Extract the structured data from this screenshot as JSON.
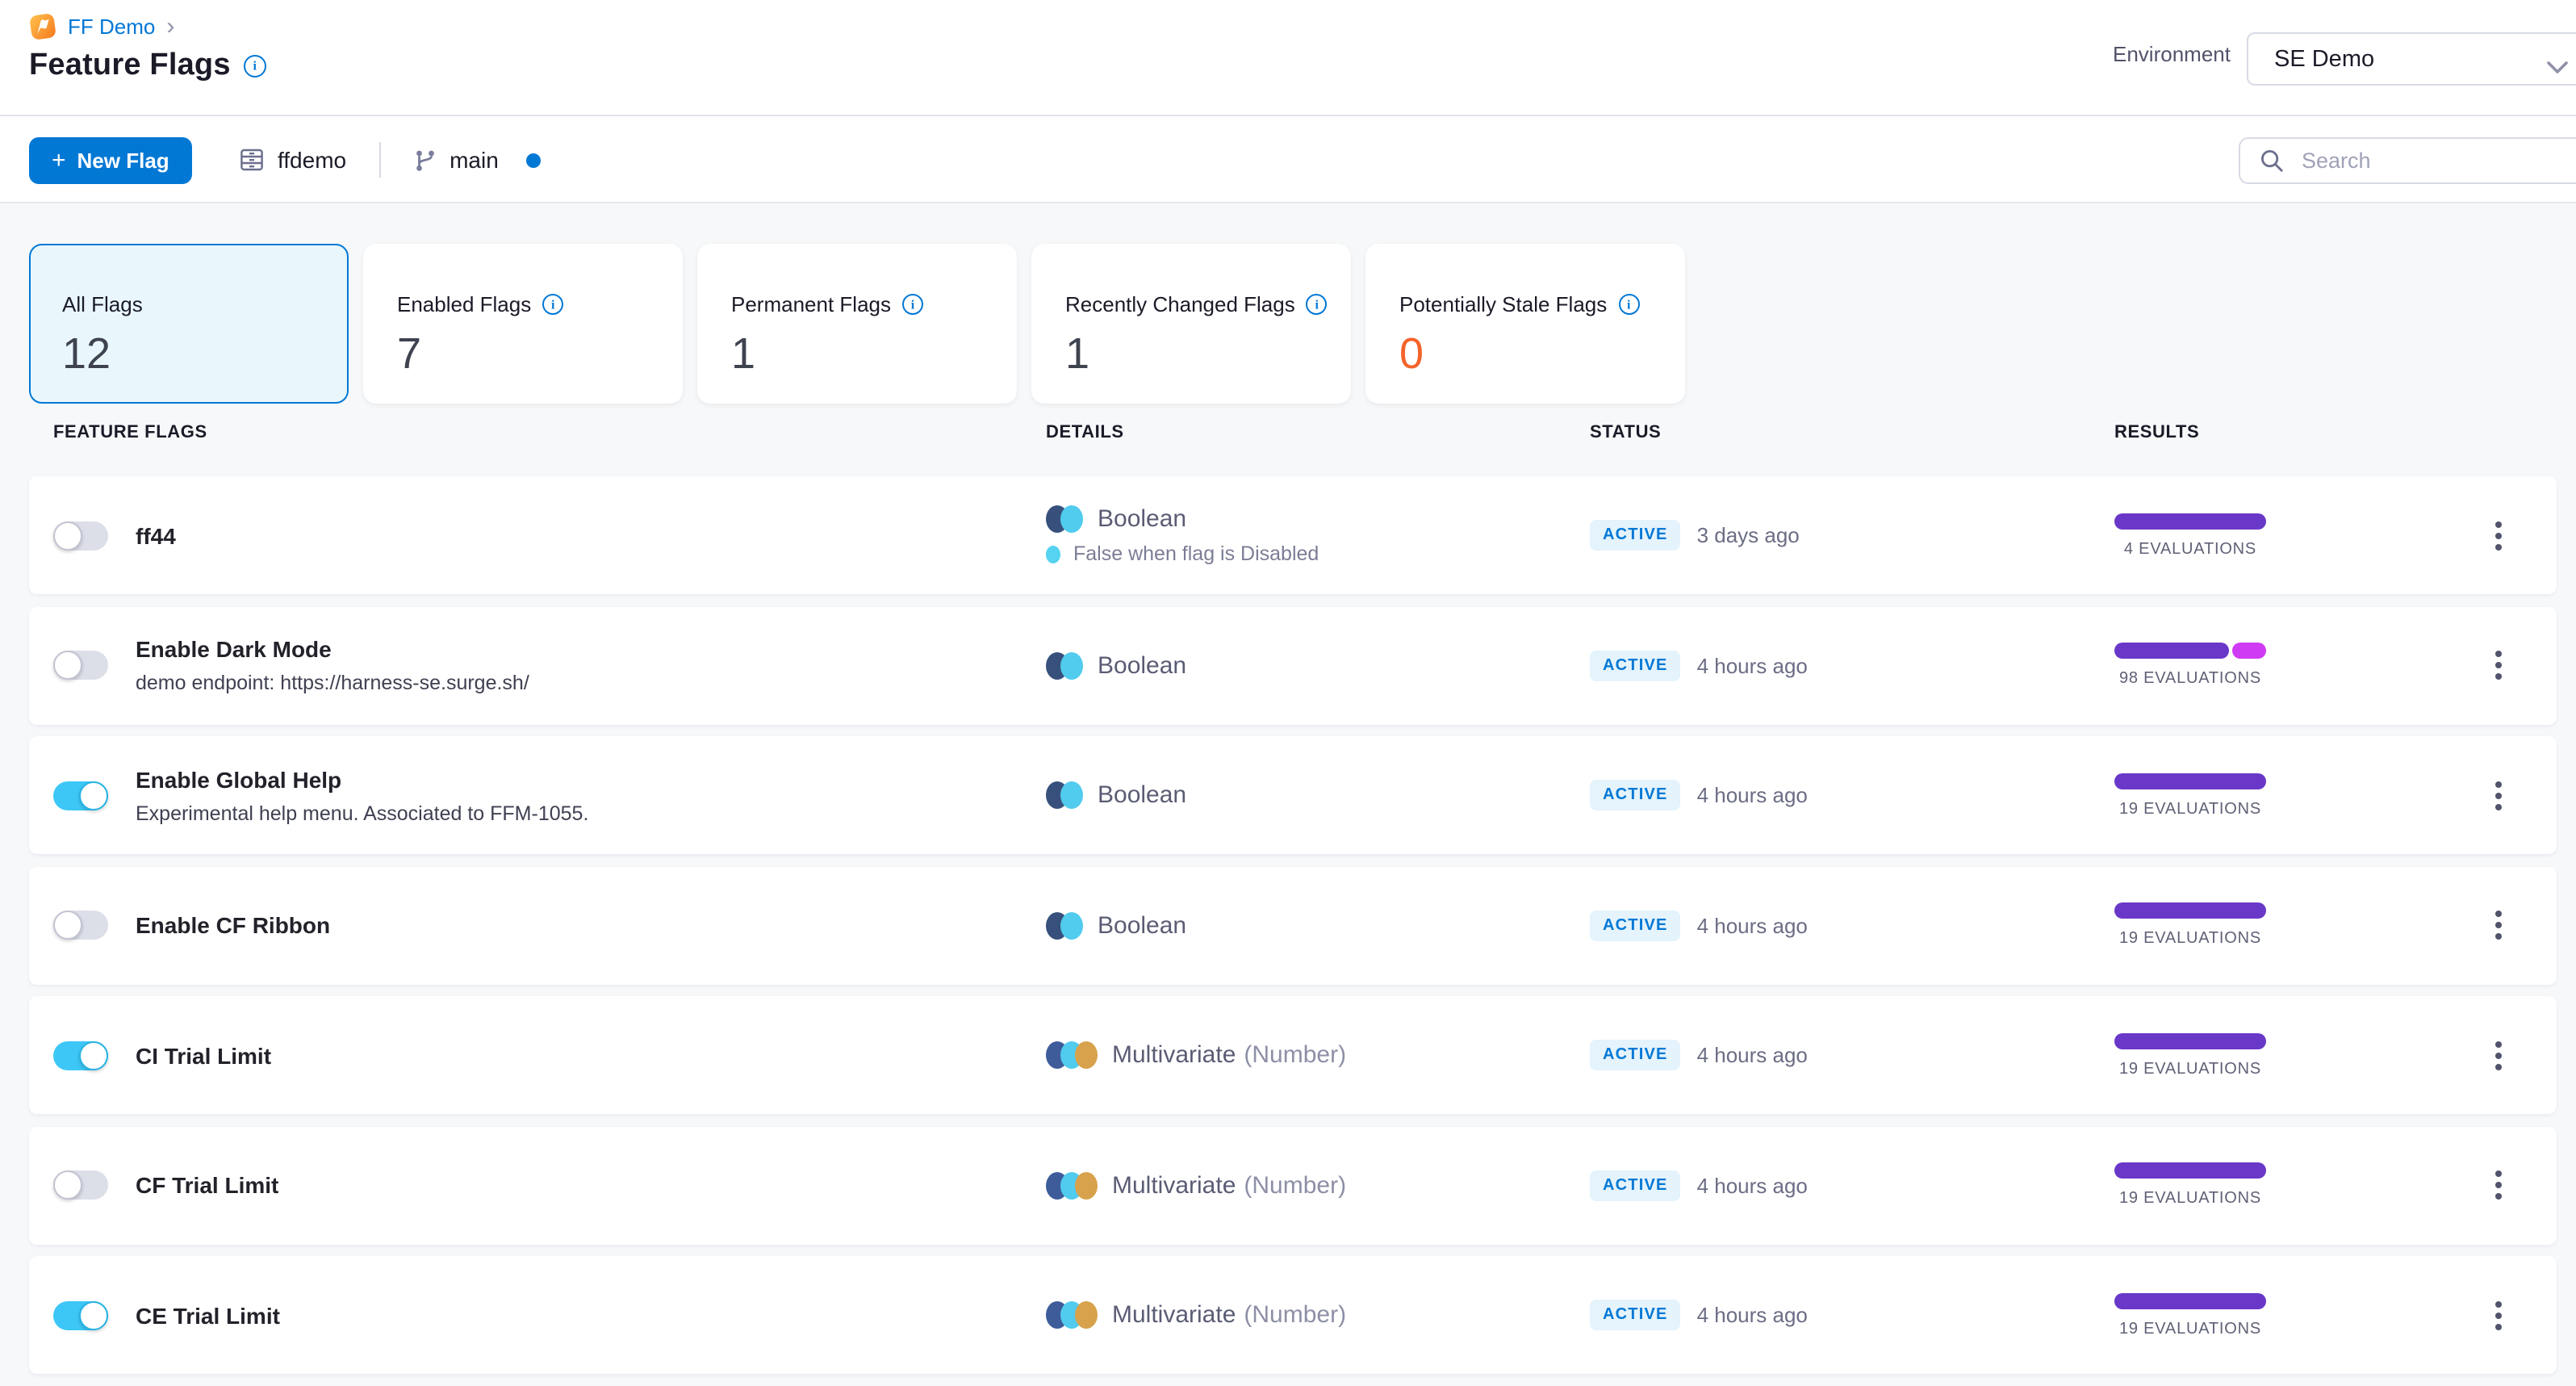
{
  "breadcrumb": {
    "project": "FF Demo",
    "chevron": "›"
  },
  "header": {
    "title": "Feature Flags",
    "environment_label": "Environment",
    "environment_value": "SE Demo"
  },
  "toolbar": {
    "new_flag_plus": "+",
    "new_flag_label": "New Flag",
    "repo_name": "ffdemo",
    "branch_name": "main",
    "search_placeholder": "Search"
  },
  "colors": {
    "accent_blue": "#0278d5",
    "toggle_on": "#3dc7f6",
    "bar_purple": "#6938c8",
    "bar_magenta": "#cf3bf3",
    "stale_orange": "#f4632a",
    "badge_bg": "#e4f3fc"
  },
  "icons": [
    "feature-flags-logo",
    "info-icon",
    "chevron-down-icon",
    "plus-icon",
    "repo-icon",
    "git-branch-icon",
    "branch-status-dot",
    "search-icon",
    "kebab-menu-icon",
    "boolean-type-icon",
    "multivariate-type-icon"
  ],
  "stats": [
    {
      "label": "All Flags",
      "value": "12",
      "selected": true,
      "info": false
    },
    {
      "label": "Enabled Flags",
      "value": "7",
      "selected": false,
      "info": true
    },
    {
      "label": "Permanent Flags",
      "value": "1",
      "selected": false,
      "info": true
    },
    {
      "label": "Recently Changed Flags",
      "value": "1",
      "selected": false,
      "info": true
    },
    {
      "label": "Potentially Stale Flags",
      "value": "0",
      "selected": false,
      "info": true,
      "value_color": "#f4632a"
    }
  ],
  "table": {
    "columns": [
      "FEATURE FLAGS",
      "DETAILS",
      "STATUS",
      "RESULTS"
    ],
    "rows": [
      {
        "name": "ff44",
        "description": "",
        "enabled": false,
        "type_label": "Boolean",
        "type_detail": "",
        "type_icon_colors": [
          "#37517c",
          "#51cbee"
        ],
        "variation_note": "False when flag is Disabled",
        "variation_dot_color": "#55d3f0",
        "status": "ACTIVE",
        "time": "3 days ago",
        "evaluations": "4 EVALUATIONS",
        "bar": [
          {
            "color": "#6938c8",
            "width": 94
          }
        ]
      },
      {
        "name": "Enable Dark Mode",
        "description": "demo endpoint: https://harness-se.surge.sh/",
        "enabled": false,
        "type_label": "Boolean",
        "type_detail": "",
        "type_icon_colors": [
          "#37517c",
          "#51cbee"
        ],
        "variation_note": "",
        "variation_dot_color": "",
        "status": "ACTIVE",
        "time": "4 hours ago",
        "evaluations": "98 EVALUATIONS",
        "bar": [
          {
            "color": "#6938c8",
            "width": 71
          },
          {
            "color": "#cf3bf3",
            "width": 21
          }
        ]
      },
      {
        "name": "Enable Global Help",
        "description": "Experimental help menu. Associated to FFM-1055.",
        "enabled": true,
        "type_label": "Boolean",
        "type_detail": "",
        "type_icon_colors": [
          "#37517c",
          "#51cbee"
        ],
        "variation_note": "",
        "variation_dot_color": "",
        "status": "ACTIVE",
        "time": "4 hours ago",
        "evaluations": "19 EVALUATIONS",
        "bar": [
          {
            "color": "#6938c8",
            "width": 94
          }
        ]
      },
      {
        "name": "Enable CF Ribbon",
        "description": "",
        "enabled": false,
        "type_label": "Boolean",
        "type_detail": "",
        "type_icon_colors": [
          "#37517c",
          "#51cbee"
        ],
        "variation_note": "",
        "variation_dot_color": "",
        "status": "ACTIVE",
        "time": "4 hours ago",
        "evaluations": "19 EVALUATIONS",
        "bar": [
          {
            "color": "#6938c8",
            "width": 94
          }
        ]
      },
      {
        "name": "CI Trial Limit",
        "description": "",
        "enabled": true,
        "type_label": "Multivariate",
        "type_detail": "(Number)",
        "type_icon_colors": [
          "#3e5c9a",
          "#51cbee",
          "#d7a24b"
        ],
        "variation_note": "",
        "variation_dot_color": "",
        "status": "ACTIVE",
        "time": "4 hours ago",
        "evaluations": "19 EVALUATIONS",
        "bar": [
          {
            "color": "#6938c8",
            "width": 94
          }
        ]
      },
      {
        "name": "CF Trial Limit",
        "description": "",
        "enabled": false,
        "type_label": "Multivariate",
        "type_detail": "(Number)",
        "type_icon_colors": [
          "#3e5c9a",
          "#51cbee",
          "#d7a24b"
        ],
        "variation_note": "",
        "variation_dot_color": "",
        "status": "ACTIVE",
        "time": "4 hours ago",
        "evaluations": "19 EVALUATIONS",
        "bar": [
          {
            "color": "#6938c8",
            "width": 94
          }
        ]
      },
      {
        "name": "CE Trial Limit",
        "description": "",
        "enabled": true,
        "type_label": "Multivariate",
        "type_detail": "(Number)",
        "type_icon_colors": [
          "#3e5c9a",
          "#51cbee",
          "#d7a24b"
        ],
        "variation_note": "",
        "variation_dot_color": "",
        "status": "ACTIVE",
        "time": "4 hours ago",
        "evaluations": "19 EVALUATIONS",
        "bar": [
          {
            "color": "#6938c8",
            "width": 94
          }
        ]
      }
    ]
  }
}
